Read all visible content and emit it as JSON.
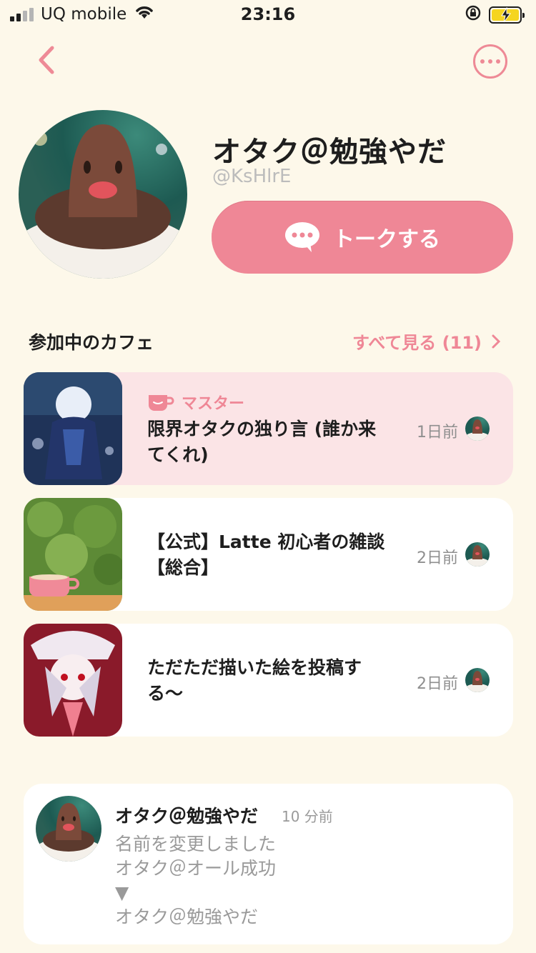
{
  "status_bar": {
    "carrier": "UQ mobile",
    "time": "23:16"
  },
  "nav": {
    "back_icon": "chevron-left-icon",
    "more_icon": "ellipsis-circle-icon"
  },
  "profile": {
    "display_name": "オタク＠勉強やだ",
    "handle": "@KsHlrE",
    "talk_button": "トークする"
  },
  "cafes": {
    "section_title": "参加中のカフェ",
    "see_all": "すべて見る (11)",
    "items": [
      {
        "badge": "マスター",
        "name": "限界オタクの独り言 (誰か来てくれ)",
        "time": "1日前"
      },
      {
        "badge": "",
        "name": "【公式】Latte 初心者の雑談【総合】",
        "time": "2日前"
      },
      {
        "badge": "",
        "name": "ただただ描いた絵を投稿する〜",
        "time": "2日前"
      }
    ]
  },
  "activity": {
    "user": "オタク＠勉強やだ",
    "time": "10 分前",
    "lines": [
      "名前を変更しました",
      "オタク＠オール成功",
      "▼",
      "オタク＠勉強やだ"
    ]
  },
  "colors": {
    "background": "#fdf8ea",
    "accent": "#ef8796",
    "master_card": "#fbe4e6",
    "card": "#ffffff"
  }
}
